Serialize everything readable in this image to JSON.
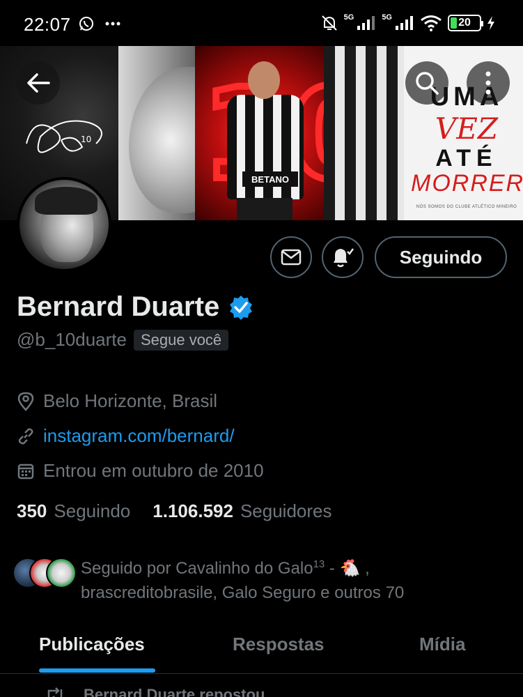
{
  "status_bar": {
    "time": "22:07",
    "network_1": "5G",
    "network_2": "5G",
    "battery": "20",
    "battery_level": 0.2
  },
  "banner": {
    "slogan_line1": "UMA",
    "slogan_line2": "VEZ",
    "slogan_line3": "ATÉ",
    "slogan_line4": "MORRER",
    "small_print": "NÓS SOMOS DO CLUBE ATLÉTICO MINEIRO",
    "sponsor": "BETANO"
  },
  "profile": {
    "display_name": "Bernard Duarte",
    "handle": "@b_10duarte",
    "follows_you": "Segue você",
    "location": "Belo Horizonte, Brasil",
    "link": "instagram.com/bernard/",
    "joined": "Entrou em outubro de 2010",
    "following_count": "350",
    "following_label": "Seguindo",
    "followers_count": "1.106.592",
    "followers_label": "Seguidores",
    "followed_by_prefix": "Seguido por Cavalinho do Galo",
    "followed_by_sup": "13",
    "followed_by_suffix": " - 🐔 , brascreditobrasile, Galo Seguro e outros 70"
  },
  "actions": {
    "follow_button": "Seguindo"
  },
  "tabs": [
    {
      "label": "Publicações",
      "active": true
    },
    {
      "label": "Respostas",
      "active": false
    },
    {
      "label": "Mídia",
      "active": false
    }
  ],
  "feed": {
    "repost_text": "Bernard Duarte repostou"
  },
  "colors": {
    "accent": "#1d9bf0",
    "background": "#000000",
    "secondary_text": "#71767b",
    "battery_green": "#3ee05a"
  }
}
